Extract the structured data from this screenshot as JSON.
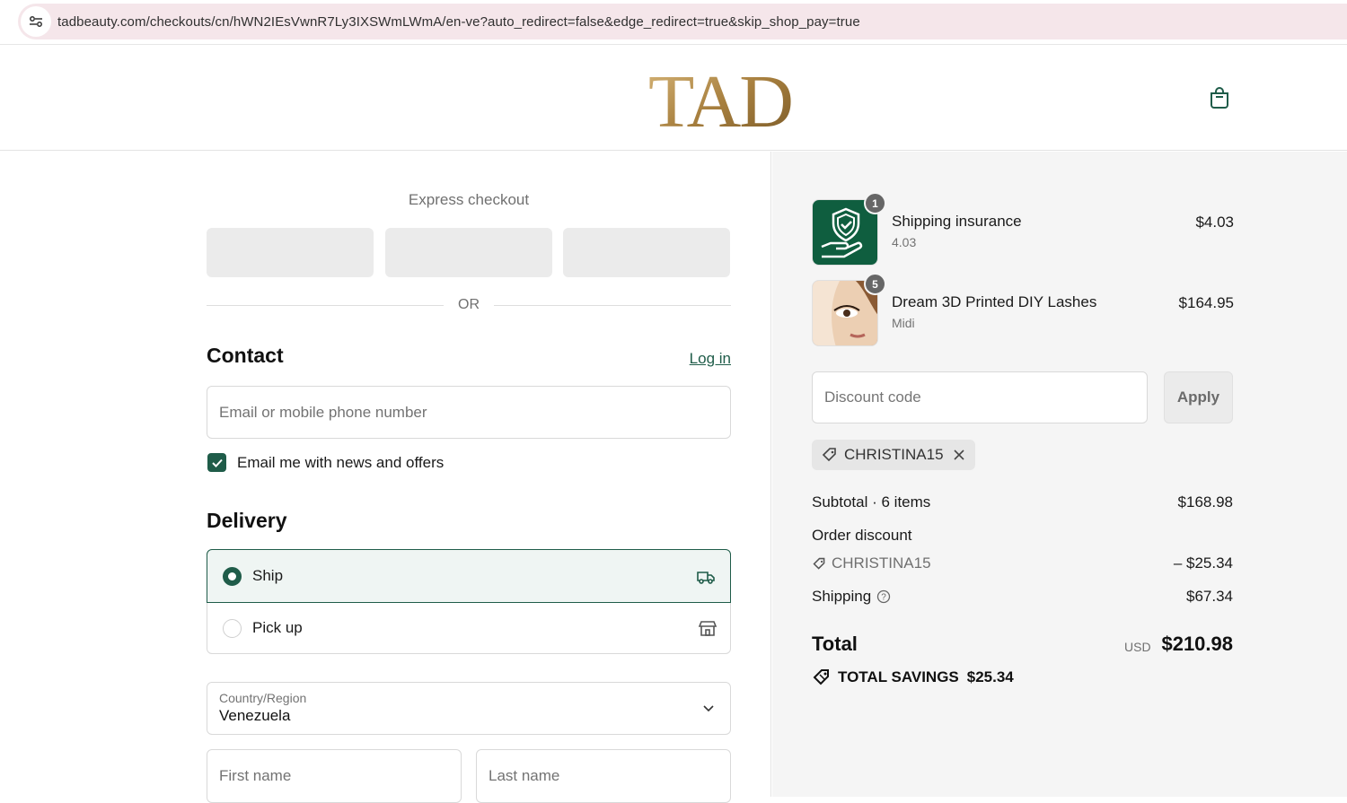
{
  "browser": {
    "url": "tadbeauty.com/checkouts/cn/hWN2IEsVwnR7Ly3IXSWmLWmA/en-ve?auto_redirect=false&edge_redirect=true&skip_shop_pay=true"
  },
  "header": {
    "logo_text": "TAD"
  },
  "express": {
    "title": "Express checkout",
    "or": "OR"
  },
  "contact": {
    "title": "Contact",
    "login": "Log in",
    "email_placeholder": "Email or mobile phone number",
    "news_label": "Email me with news and offers",
    "news_checked": true
  },
  "delivery": {
    "title": "Delivery",
    "options": [
      {
        "label": "Ship",
        "selected": true
      },
      {
        "label": "Pick up",
        "selected": false
      }
    ],
    "country_label": "Country/Region",
    "country_value": "Venezuela",
    "first_name_placeholder": "First name",
    "last_name_placeholder": "Last name"
  },
  "order": {
    "items": [
      {
        "name": "Shipping insurance",
        "variant": "4.03",
        "price": "$4.03",
        "qty": "1"
      },
      {
        "name": "Dream 3D Printed DIY Lashes",
        "variant": "Midi",
        "price": "$164.95",
        "qty": "5"
      }
    ],
    "discount_placeholder": "Discount code",
    "apply": "Apply",
    "applied_code": "CHRISTINA15",
    "subtotal_label": "Subtotal · 6 items",
    "subtotal_value": "$168.98",
    "order_discount_label": "Order discount",
    "discount_code": "CHRISTINA15",
    "discount_value": "– $25.34",
    "shipping_label": "Shipping",
    "shipping_value": "$67.34",
    "total_label": "Total",
    "currency": "USD",
    "total_value": "$210.98",
    "savings_label": "TOTAL SAVINGS",
    "savings_value": "$25.34"
  },
  "colors": {
    "accent": "#1f5c49",
    "sidebar_bg": "#f5f5f5",
    "url_bar": "#f5e6ea",
    "logo_gold": "#b8925a"
  }
}
